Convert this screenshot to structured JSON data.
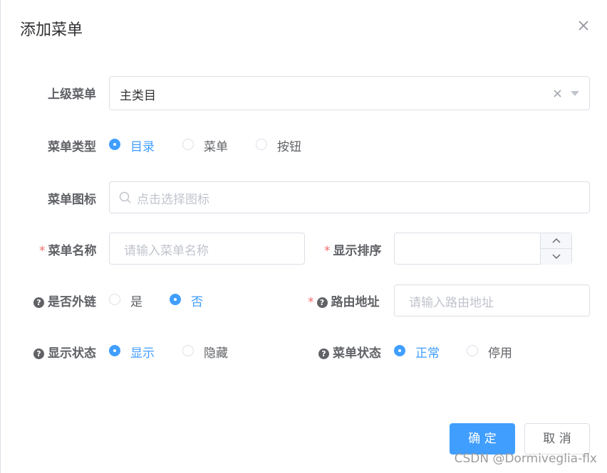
{
  "dialog": {
    "title": "添加菜单"
  },
  "form": {
    "parent_menu": {
      "label": "上级菜单",
      "value": "主类目"
    },
    "menu_type": {
      "label": "菜单类型",
      "options": [
        "目录",
        "菜单",
        "按钮"
      ],
      "selected": "目录"
    },
    "menu_icon": {
      "label": "菜单图标",
      "placeholder": "点击选择图标"
    },
    "menu_name": {
      "label": "菜单名称",
      "required": "*",
      "placeholder": "请输入菜单名称"
    },
    "display_order": {
      "label": "显示排序",
      "required": "*"
    },
    "is_external": {
      "label": "是否外链",
      "options": [
        "是",
        "否"
      ],
      "selected": "否"
    },
    "route_path": {
      "label": "路由地址",
      "required": "*",
      "placeholder": "请输入路由地址"
    },
    "visible": {
      "label": "显示状态",
      "options": [
        "显示",
        "隐藏"
      ],
      "selected": "显示"
    },
    "status": {
      "label": "菜单状态",
      "options": [
        "正常",
        "停用"
      ],
      "selected": "正常"
    }
  },
  "footer": {
    "confirm_label": "确 定",
    "cancel_label": "取 消"
  },
  "watermark": "CSDN @Dormiveglia-flx",
  "colors": {
    "primary": "#409eff",
    "required": "#f56c6c",
    "border": "#dcdfe6"
  }
}
